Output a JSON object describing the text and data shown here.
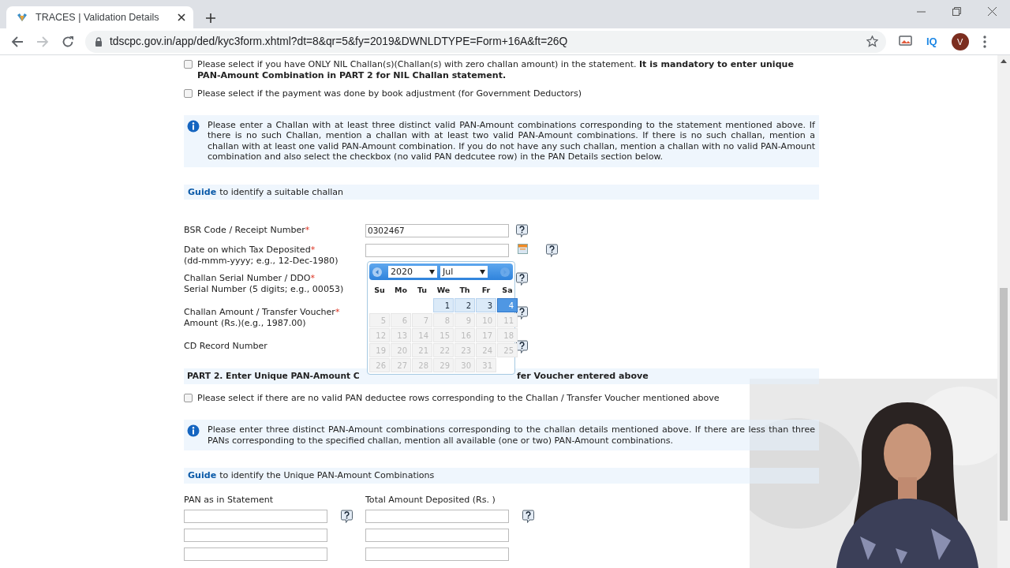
{
  "browser": {
    "tab": {
      "title": "TRACES | Validation Details",
      "selected": true
    },
    "url": "tdscpc.gov.in/app/ded/kyc3form.xhtml?dt=8&qr=5&fy=2019&DWNLDTYPE=Form+16A&ft=26Q",
    "extension_label": "IQ",
    "profile_initial": "V"
  },
  "statement_options": [
    {
      "text": "Please select if you have ONLY NIL Challan(s)(Challan(s) with zero challan amount) in the statement. **It is mandatory to enter unique PAN-Amount Combination in PART 2 for NIL Challan statement.**",
      "checked": false
    },
    {
      "text": "Please select if the payment was done by book adjustment (for Government Deductors)",
      "checked": false
    }
  ],
  "notice": "Please enter a Challan with at least three distinct valid PAN-Amount combinations corresponding to the statement mentioned above. If there is no such Challan, mention a challan with at least two valid PAN-Amount combinations. If there is no such challan, mention a challan with at least one valid PAN-Amount combination. If you do not have any such challan, mention a challan with no valid PAN-Amount combination and also select the checkbox (no valid PAN dedcutee row) in the PAN Details section below.",
  "guide": {
    "link": "Guide",
    "text": "to identify a suitable challan"
  },
  "challan_fields": [
    {
      "kind": "text",
      "label": "BSR Code / Receipt Number",
      "required_mark": "*",
      "value": "0302467"
    },
    {
      "kind": "date",
      "label": "Date on which Tax Deposited",
      "required_mark": "*",
      "note": "(dd-mmm-yyyy; e.g., 12-Dec-1980)"
    },
    {
      "kind": "covered",
      "label": "Challan Serial Number / DDO",
      "required_mark": "*",
      "note": "Serial Number (5 digits; e.g., 00053)"
    },
    {
      "kind": "covered",
      "label": "Challan Amount / Transfer Voucher",
      "required_mark": "*",
      "note": "Amount (Rs.)(e.g., 1987.00)"
    },
    {
      "kind": "covered",
      "label": "CD Record Number"
    }
  ],
  "date_picker": {
    "year": "2020",
    "month": "Jul",
    "weekdays": [
      "Su",
      "Mo",
      "Tu",
      "We",
      "Th",
      "Fr",
      "Sa"
    ],
    "weeks": [
      [
        {
          "kind": "blank"
        },
        {
          "kind": "blank"
        },
        {
          "kind": "blank"
        },
        {
          "kind": "day",
          "day": "1",
          "disabled": false,
          "selected": false
        },
        {
          "kind": "day",
          "day": "2",
          "disabled": false,
          "selected": false
        },
        {
          "kind": "day",
          "day": "3",
          "disabled": false,
          "selected": false
        },
        {
          "kind": "day",
          "day": "4",
          "disabled": false,
          "selected": true
        }
      ],
      [
        {
          "kind": "day",
          "day": "5",
          "disabled": true,
          "selected": false
        },
        {
          "kind": "day",
          "day": "6",
          "disabled": true,
          "selected": false
        },
        {
          "kind": "day",
          "day": "7",
          "disabled": true,
          "selected": false
        },
        {
          "kind": "day",
          "day": "8",
          "disabled": true,
          "selected": false
        },
        {
          "kind": "day",
          "day": "9",
          "disabled": true,
          "selected": false
        },
        {
          "kind": "day",
          "day": "10",
          "disabled": true,
          "selected": false
        },
        {
          "kind": "day",
          "day": "11",
          "disabled": true,
          "selected": false
        }
      ],
      [
        {
          "kind": "day",
          "day": "12",
          "disabled": true,
          "selected": false
        },
        {
          "kind": "day",
          "day": "13",
          "disabled": true,
          "selected": false
        },
        {
          "kind": "day",
          "day": "14",
          "disabled": true,
          "selected": false
        },
        {
          "kind": "day",
          "day": "15",
          "disabled": true,
          "selected": false
        },
        {
          "kind": "day",
          "day": "16",
          "disabled": true,
          "selected": false
        },
        {
          "kind": "day",
          "day": "17",
          "disabled": true,
          "selected": false
        },
        {
          "kind": "day",
          "day": "18",
          "disabled": true,
          "selected": false
        }
      ],
      [
        {
          "kind": "day",
          "day": "19",
          "disabled": true,
          "selected": false
        },
        {
          "kind": "day",
          "day": "20",
          "disabled": true,
          "selected": false
        },
        {
          "kind": "day",
          "day": "21",
          "disabled": true,
          "selected": false
        },
        {
          "kind": "day",
          "day": "22",
          "disabled": true,
          "selected": false
        },
        {
          "kind": "day",
          "day": "23",
          "disabled": true,
          "selected": false
        },
        {
          "kind": "day",
          "day": "24",
          "disabled": true,
          "selected": false
        },
        {
          "kind": "day",
          "day": "25",
          "disabled": true,
          "selected": false
        }
      ],
      [
        {
          "kind": "day",
          "day": "26",
          "disabled": true,
          "selected": false
        },
        {
          "kind": "day",
          "day": "27",
          "disabled": true,
          "selected": false
        },
        {
          "kind": "day",
          "day": "28",
          "disabled": true,
          "selected": false
        },
        {
          "kind": "day",
          "day": "29",
          "disabled": true,
          "selected": false
        },
        {
          "kind": "day",
          "day": "30",
          "disabled": true,
          "selected": false
        },
        {
          "kind": "day",
          "day": "31",
          "disabled": true,
          "selected": false
        },
        {
          "kind": "blank"
        }
      ]
    ]
  },
  "part2": {
    "heading_parts": [
      "PART 2. Enter Unique PAN-Amount C",
      "fer Voucher entered above"
    ],
    "option": {
      "text": "Please select if there are no valid PAN deductee rows corresponding to the Challan / Transfer Voucher mentioned above",
      "checked": false
    },
    "notice": "Please enter three distinct PAN-Amount combinations corresponding to the challan details mentioned above. If there are less than three PANs corresponding to the specified challan, mention all available (one or two) PAN-Amount combinations.",
    "guide": {
      "link": "Guide",
      "text": "to identify the Unique PAN-Amount Combinations"
    },
    "columns": [
      "PAN as in Statement",
      "Total Amount Deposited (Rs. )"
    ]
  }
}
